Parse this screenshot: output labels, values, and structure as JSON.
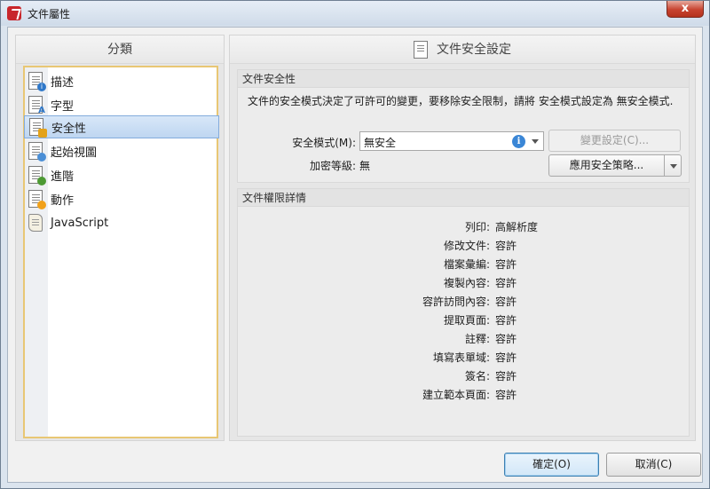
{
  "window": {
    "title": "文件屬性",
    "close_label": "x"
  },
  "left_panel": {
    "header": "分類",
    "items": [
      {
        "label": "描述",
        "icon": "doc-info-icon",
        "selected": false
      },
      {
        "label": "字型",
        "icon": "doc-font-icon",
        "selected": false
      },
      {
        "label": "安全性",
        "icon": "doc-lock-icon",
        "selected": true
      },
      {
        "label": "起始視圖",
        "icon": "doc-view-icon",
        "selected": false
      },
      {
        "label": "進階",
        "icon": "doc-gear-icon",
        "selected": false
      },
      {
        "label": "動作",
        "icon": "doc-action-icon",
        "selected": false
      },
      {
        "label": "JavaScript",
        "icon": "script-icon",
        "selected": false
      }
    ]
  },
  "right_panel": {
    "header": "文件安全設定",
    "security_section": {
      "title": "文件安全性",
      "description": "文件的安全模式決定了可許可的變更，要移除安全限制，請將 安全模式設定為 無安全模式.",
      "mode_label": "安全模式(M):",
      "mode_value": "無安全",
      "change_settings_button": "變更設定(C)...",
      "encryption_label": "加密等級:",
      "encryption_value": "無",
      "apply_policy_button": "應用安全策略..."
    },
    "permissions_section": {
      "title": "文件權限詳情",
      "rows": [
        {
          "label": "列印:",
          "value": "高解析度"
        },
        {
          "label": "修改文件:",
          "value": "容許"
        },
        {
          "label": "檔案彙編:",
          "value": "容許"
        },
        {
          "label": "複製內容:",
          "value": "容許"
        },
        {
          "label": "容許訪問內容:",
          "value": "容許"
        },
        {
          "label": "提取頁面:",
          "value": "容許"
        },
        {
          "label": "註釋:",
          "value": "容許"
        },
        {
          "label": "填寫表單域:",
          "value": "容許"
        },
        {
          "label": "簽名:",
          "value": "容許"
        },
        {
          "label": "建立範本頁面:",
          "value": "容許"
        }
      ]
    }
  },
  "footer": {
    "ok_button": "確定(O)",
    "cancel_button": "取消(C)"
  },
  "colors": {
    "selection": "#c5dcf4",
    "list_border": "#e8c774",
    "lock_badge": "#e3a21a"
  }
}
